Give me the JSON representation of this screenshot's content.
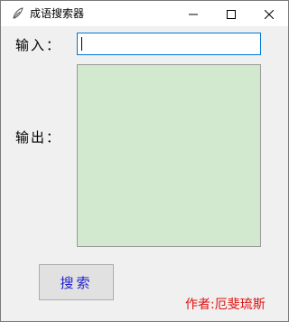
{
  "window": {
    "title": "成语搜索器",
    "icon": "feather-app-icon",
    "controls": [
      "minimize-icon",
      "maximize-icon",
      "close-icon"
    ]
  },
  "form": {
    "input_label": "输入：",
    "input_value": "",
    "output_label": "输出：",
    "output_text": ""
  },
  "actions": {
    "search_label": "搜索"
  },
  "footer": {
    "author": "作者:厄斐琉斯"
  },
  "colors": {
    "output_background": "#d2e9cf",
    "author_text": "#e01010",
    "search_text": "#1f1fcf",
    "input_focus_border": "#0078d7"
  }
}
